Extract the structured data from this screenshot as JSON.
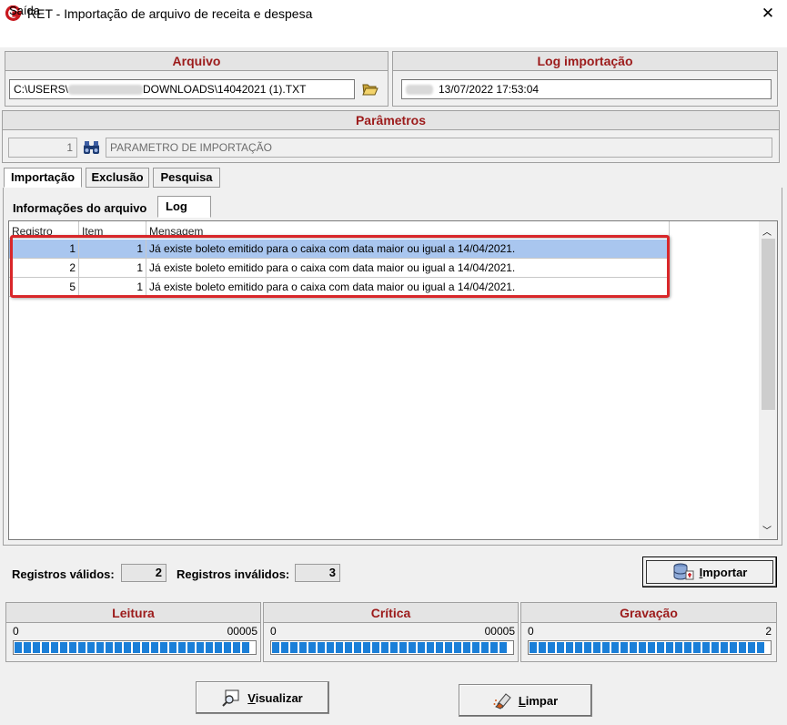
{
  "window": {
    "title": "RET - Importação de arquivo de receita e despesa",
    "close_glyph": "✕",
    "icon": "app-logo-icon"
  },
  "menu": {
    "items": [
      "Saída"
    ]
  },
  "arquivo": {
    "header": "Arquivo",
    "path_prefix": "C:\\USERS\\",
    "path_suffix": "DOWNLOADS\\14042021 (1).TXT",
    "browse_icon": "open-folder-icon"
  },
  "log_importacao": {
    "header": "Log importação",
    "timestamp": "13/07/2022 17:53:04"
  },
  "parametros": {
    "header": "Parâmetros",
    "code": "1",
    "lookup_icon": "binoculars-icon",
    "description": "PARAMETRO DE IMPORTAÇÃO"
  },
  "main_tabs": [
    "Importação",
    "Exclusão",
    "Pesquisa"
  ],
  "sub_tabs": [
    "Informações do arquivo",
    "Log"
  ],
  "grid": {
    "columns": [
      "Registro",
      "Item",
      "Mensagem"
    ],
    "rows": [
      {
        "registro": "1",
        "item": "1",
        "mensagem": "Já existe boleto emitido para o caixa com data maior ou igual a 14/04/2021.",
        "selected": true
      },
      {
        "registro": "2",
        "item": "1",
        "mensagem": "Já existe boleto emitido para o caixa com data maior ou igual a 14/04/2021.",
        "selected": false
      },
      {
        "registro": "5",
        "item": "1",
        "mensagem": "Já existe boleto emitido para o caixa com data maior ou igual a 14/04/2021.",
        "selected": false
      }
    ]
  },
  "counts": {
    "validos_label": "Registros válidos:",
    "validos": "2",
    "invalidos_label": "Registros inválidos:",
    "invalidos": "3"
  },
  "buttons": {
    "importar": {
      "accel": "I",
      "rest": "mportar",
      "icon": "database-import-icon"
    },
    "visualizar": {
      "accel": "V",
      "rest": "isualizar",
      "icon": "preview-icon"
    },
    "limpar": {
      "accel": "L",
      "rest": "impar",
      "icon": "eraser-icon"
    }
  },
  "progress": [
    {
      "title": "Leitura",
      "min": "0",
      "max": "00005",
      "fraction": 1.0
    },
    {
      "title": "Crítica",
      "min": "0",
      "max": "00005",
      "fraction": 1.0
    },
    {
      "title": "Gravação",
      "min": "0",
      "max": "2",
      "fraction": 1.0
    }
  ],
  "colors": {
    "header_text": "#9c1b1b",
    "selection": "#a9c6ef",
    "highlight_box": "#d9272a",
    "progress_fill": "#1b7fd8"
  }
}
